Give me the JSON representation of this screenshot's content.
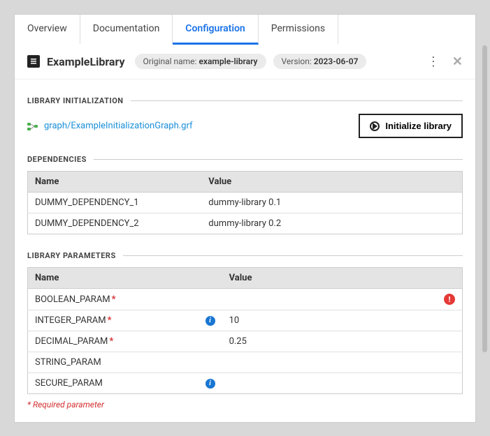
{
  "tabs": {
    "overview": "Overview",
    "documentation": "Documentation",
    "configuration": "Configuration",
    "permissions": "Permissions"
  },
  "header": {
    "name": "ExampleLibrary",
    "original_label": "Original name:",
    "original_value": "example-library",
    "version_label": "Version:",
    "version_value": "2023-06-07"
  },
  "init": {
    "section": "LIBRARY INITIALIZATION",
    "graph_link": "graph/ExampleInitializationGraph.grf",
    "button": "Initialize library"
  },
  "deps": {
    "section": "DEPENDENCIES",
    "col_name": "Name",
    "col_value": "Value",
    "rows": [
      {
        "name": "DUMMY_DEPENDENCY_1",
        "value": "dummy-library 0.1"
      },
      {
        "name": "DUMMY_DEPENDENCY_2",
        "value": "dummy-library 0.2"
      }
    ]
  },
  "params": {
    "section": "LIBRARY PARAMETERS",
    "col_name": "Name",
    "col_value": "Value",
    "rows": [
      {
        "name": "BOOLEAN_PARAM",
        "required": true,
        "info": false,
        "value": "",
        "warn": true
      },
      {
        "name": "INTEGER_PARAM",
        "required": true,
        "info": true,
        "value": "10",
        "warn": false
      },
      {
        "name": "DECIMAL_PARAM",
        "required": true,
        "info": false,
        "value": "0.25",
        "warn": false
      },
      {
        "name": "STRING_PARAM",
        "required": false,
        "info": false,
        "value": "",
        "warn": false
      },
      {
        "name": "SECURE_PARAM",
        "required": false,
        "info": true,
        "value": "",
        "warn": false
      }
    ],
    "footnote_marker": "*",
    "footnote": "Required parameter"
  }
}
